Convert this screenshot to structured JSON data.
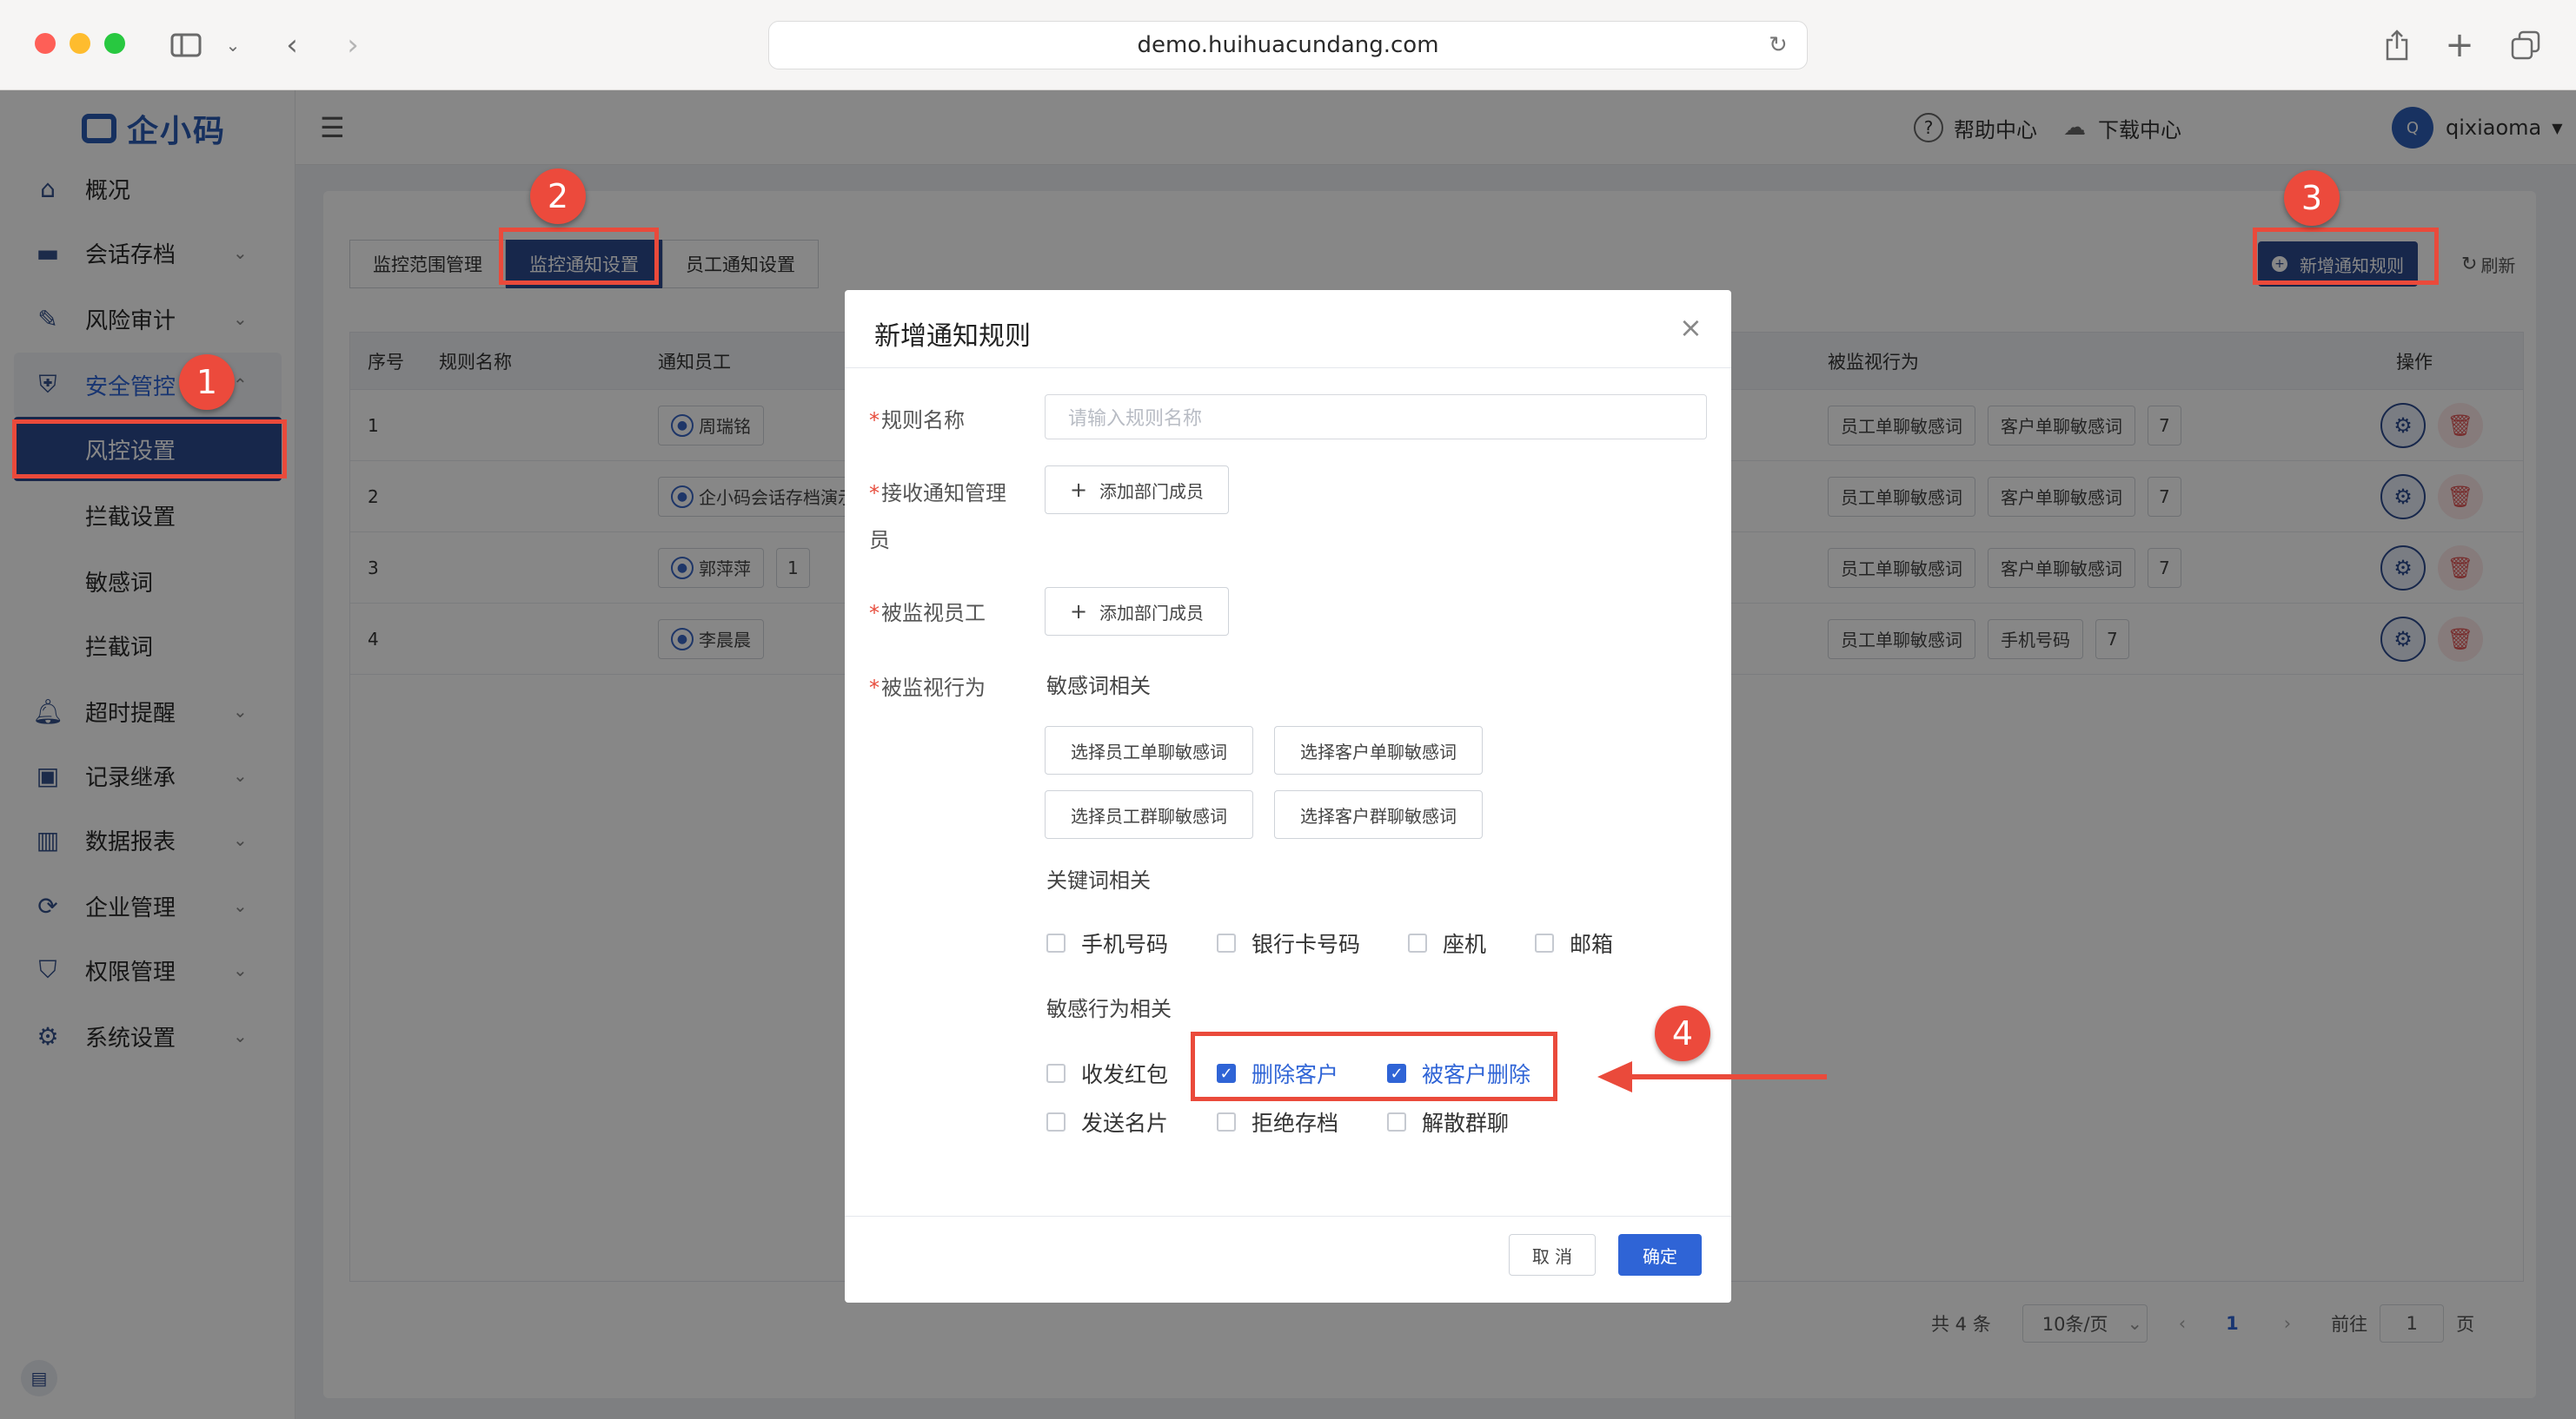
{
  "browser": {
    "url": "demo.huihuacundang.com"
  },
  "app": {
    "logo_text": "企小码",
    "header": {
      "help_label": "帮助中心",
      "download_label": "下载中心",
      "user_initial": "Q",
      "user_name": "qixiaoma"
    },
    "sidebar": {
      "items": [
        {
          "label": "概况",
          "icon": "home-icon"
        },
        {
          "label": "会话存档",
          "icon": "folder-icon"
        },
        {
          "label": "风险审计",
          "icon": "edit-icon"
        },
        {
          "label": "安全管控",
          "icon": "shield-icon"
        },
        {
          "label": "超时提醒",
          "icon": "bell-icon"
        },
        {
          "label": "记录继承",
          "icon": "record-icon"
        },
        {
          "label": "数据报表",
          "icon": "chart-icon"
        },
        {
          "label": "企业管理",
          "icon": "refresh-icon"
        },
        {
          "label": "权限管理",
          "icon": "lock-shield-icon"
        },
        {
          "label": "系统设置",
          "icon": "gear-icon"
        }
      ],
      "subitems": [
        "风控设置",
        "拦截设置",
        "敏感词",
        "拦截词"
      ]
    },
    "tabs": [
      "监控范围管理",
      "监控通知设置",
      "员工通知设置"
    ],
    "add_rule_button": "新增通知规则",
    "refresh_button": "刷新",
    "table": {
      "headers": [
        "序号",
        "规则名称",
        "通知员工",
        "被监视行为",
        "操作"
      ],
      "rows": [
        {
          "index": "1",
          "employee": "周瑞铭",
          "emp_count": "",
          "behaviors": [
            "员工单聊敏感词",
            "客户单聊敏感词"
          ],
          "more": "7"
        },
        {
          "index": "2",
          "employee": "企小码会话存档演示",
          "emp_count": "",
          "behaviors": [
            "员工单聊敏感词",
            "客户单聊敏感词"
          ],
          "more": "7"
        },
        {
          "index": "3",
          "employee": "郭萍萍",
          "emp_count": "1",
          "behaviors": [
            "员工单聊敏感词",
            "客户单聊敏感词"
          ],
          "more": "7"
        },
        {
          "index": "4",
          "employee": "李晨晨",
          "emp_count": "",
          "behaviors": [
            "员工单聊敏感词",
            "手机号码"
          ],
          "more": "7"
        }
      ]
    },
    "pagination": {
      "total": "共 4 条",
      "page_size": "10条/页",
      "current_page": "1",
      "goto_label": "前往",
      "goto_value": "1",
      "page_suffix": "页"
    }
  },
  "modal": {
    "title": "新增通知规则",
    "fields": {
      "rule_name_label": "规则名称",
      "rule_name_placeholder": "请输入规则名称",
      "receivers_label_1": "接收通知管理",
      "receivers_label_2": "员",
      "monitored_label": "被监视员工",
      "behavior_label": "被监视行为",
      "add_member_button": "添加部门成员"
    },
    "sensitive_word_section": "敏感词相关",
    "sensitive_word_buttons": [
      "选择员工单聊敏感词",
      "选择客户单聊敏感词",
      "选择员工群聊敏感词",
      "选择客户群聊敏感词"
    ],
    "keyword_section": "关键词相关",
    "keyword_options": [
      {
        "label": "手机号码",
        "checked": false
      },
      {
        "label": "银行卡号码",
        "checked": false
      },
      {
        "label": "座机",
        "checked": false
      },
      {
        "label": "邮箱",
        "checked": false
      }
    ],
    "behavior_section": "敏感行为相关",
    "behavior_options": [
      {
        "label": "收发红包",
        "checked": false
      },
      {
        "label": "删除客户",
        "checked": true
      },
      {
        "label": "被客户删除",
        "checked": true
      },
      {
        "label": "发送名片",
        "checked": false
      },
      {
        "label": "拒绝存档",
        "checked": false
      },
      {
        "label": "解散群聊",
        "checked": false
      }
    ],
    "cancel_button": "取 消",
    "confirm_button": "确定"
  },
  "annotations": [
    "1",
    "2",
    "3",
    "4"
  ],
  "colors": {
    "primary": "#2c4a8f",
    "checkbox_blue": "#2f64d6",
    "annotation_red": "#ea4a3b"
  }
}
